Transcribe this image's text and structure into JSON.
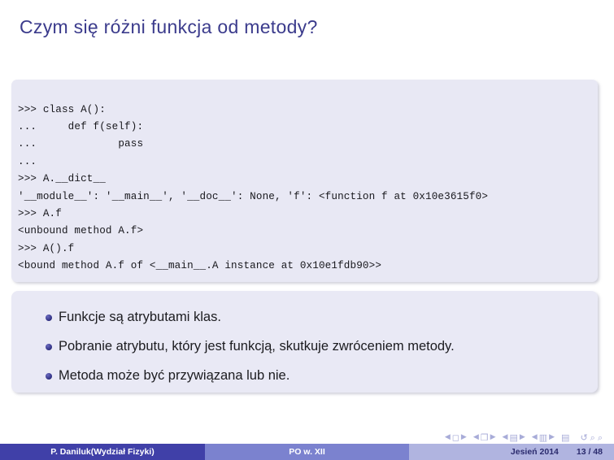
{
  "slide": {
    "title": "Czym się różni funkcja od metody?",
    "title_color": "#3b3b8c"
  },
  "code_block": {
    "language": "python-repl",
    "background": "#e8e8f4",
    "lines": [
      ">>> class A():",
      "...     def f(self):",
      "...             pass",
      "...",
      ">>> A.__dict__",
      "'__module__': '__main__', '__doc__': None, 'f': <function f at 0x10e3615f0>",
      ">>> A.f",
      "<unbound method A.f>",
      ">>> A().f",
      "<bound method A.f of <__main__.A instance at 0x10e1fdb90>>"
    ],
    "text": ">>> class A():\n...     def f(self):\n...             pass\n...\n>>> A.__dict__\n'__module__': '__main__', '__doc__': None, 'f': <function f at 0x10e3615f0>\n>>> A.f\n<unbound method A.f>\n>>> A().f\n<bound method A.f of <__main__.A instance at 0x10e1fdb90>>"
  },
  "bullets": {
    "background": "#e9e9f5",
    "bullet_color": "#34348c",
    "items": [
      {
        "text": "Funkcje są atrybutami klas."
      },
      {
        "text": "Pobranie atrybutu, który jest funkcją, skutkuje zwróceniem metody."
      },
      {
        "text": "Metoda może być przywiązana lub nie."
      }
    ]
  },
  "navigation": {
    "color": "#a8acd8",
    "groups": [
      {
        "prev": "◀",
        "glyph": "◻",
        "next": "▶",
        "name": "slide"
      },
      {
        "prev": "◀",
        "glyph": "❐",
        "next": "▶",
        "name": "frame"
      },
      {
        "prev": "◀",
        "glyph": "▤",
        "next": "▶",
        "name": "subsection"
      },
      {
        "prev": "◀",
        "glyph": "▥",
        "next": "▶",
        "name": "section"
      }
    ],
    "doc_glyph": "▤",
    "back_glyph": "↺",
    "zoom_in_glyph": "⌕",
    "zoom_out_glyph": "⌕"
  },
  "footer": {
    "author": "P. Daniluk(Wydział Fizyki)",
    "lecture": "PO w. XII",
    "term": "Jesień 2014",
    "page": "13 / 48",
    "colors": {
      "left": "#4040a8",
      "mid": "#7b82cf",
      "right": "#b0b4e0"
    }
  }
}
